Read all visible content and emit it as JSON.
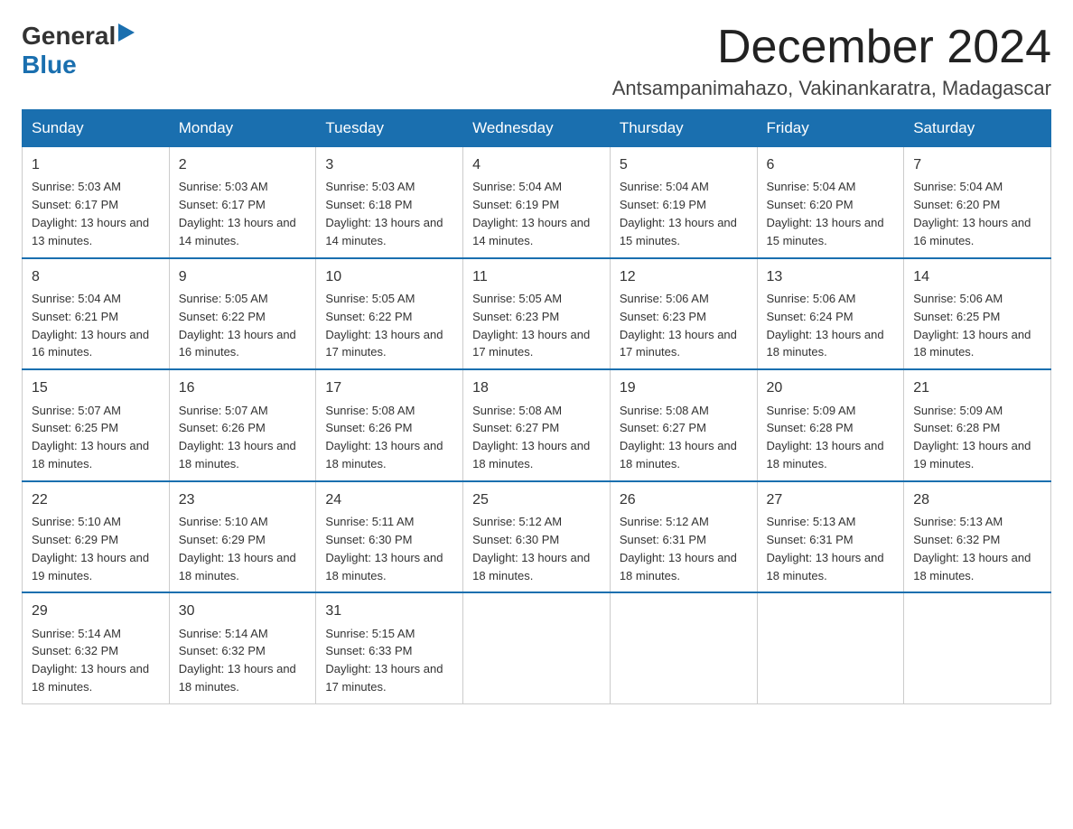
{
  "logo": {
    "general": "General",
    "blue": "Blue"
  },
  "title": {
    "month": "December 2024",
    "location": "Antsampanimahazo, Vakinankaratra, Madagascar"
  },
  "weekdays": [
    "Sunday",
    "Monday",
    "Tuesday",
    "Wednesday",
    "Thursday",
    "Friday",
    "Saturday"
  ],
  "weeks": [
    [
      {
        "num": "1",
        "sunrise": "5:03 AM",
        "sunset": "6:17 PM",
        "daylight": "13 hours and 13 minutes."
      },
      {
        "num": "2",
        "sunrise": "5:03 AM",
        "sunset": "6:17 PM",
        "daylight": "13 hours and 14 minutes."
      },
      {
        "num": "3",
        "sunrise": "5:03 AM",
        "sunset": "6:18 PM",
        "daylight": "13 hours and 14 minutes."
      },
      {
        "num": "4",
        "sunrise": "5:04 AM",
        "sunset": "6:19 PM",
        "daylight": "13 hours and 14 minutes."
      },
      {
        "num": "5",
        "sunrise": "5:04 AM",
        "sunset": "6:19 PM",
        "daylight": "13 hours and 15 minutes."
      },
      {
        "num": "6",
        "sunrise": "5:04 AM",
        "sunset": "6:20 PM",
        "daylight": "13 hours and 15 minutes."
      },
      {
        "num": "7",
        "sunrise": "5:04 AM",
        "sunset": "6:20 PM",
        "daylight": "13 hours and 16 minutes."
      }
    ],
    [
      {
        "num": "8",
        "sunrise": "5:04 AM",
        "sunset": "6:21 PM",
        "daylight": "13 hours and 16 minutes."
      },
      {
        "num": "9",
        "sunrise": "5:05 AM",
        "sunset": "6:22 PM",
        "daylight": "13 hours and 16 minutes."
      },
      {
        "num": "10",
        "sunrise": "5:05 AM",
        "sunset": "6:22 PM",
        "daylight": "13 hours and 17 minutes."
      },
      {
        "num": "11",
        "sunrise": "5:05 AM",
        "sunset": "6:23 PM",
        "daylight": "13 hours and 17 minutes."
      },
      {
        "num": "12",
        "sunrise": "5:06 AM",
        "sunset": "6:23 PM",
        "daylight": "13 hours and 17 minutes."
      },
      {
        "num": "13",
        "sunrise": "5:06 AM",
        "sunset": "6:24 PM",
        "daylight": "13 hours and 18 minutes."
      },
      {
        "num": "14",
        "sunrise": "5:06 AM",
        "sunset": "6:25 PM",
        "daylight": "13 hours and 18 minutes."
      }
    ],
    [
      {
        "num": "15",
        "sunrise": "5:07 AM",
        "sunset": "6:25 PM",
        "daylight": "13 hours and 18 minutes."
      },
      {
        "num": "16",
        "sunrise": "5:07 AM",
        "sunset": "6:26 PM",
        "daylight": "13 hours and 18 minutes."
      },
      {
        "num": "17",
        "sunrise": "5:08 AM",
        "sunset": "6:26 PM",
        "daylight": "13 hours and 18 minutes."
      },
      {
        "num": "18",
        "sunrise": "5:08 AM",
        "sunset": "6:27 PM",
        "daylight": "13 hours and 18 minutes."
      },
      {
        "num": "19",
        "sunrise": "5:08 AM",
        "sunset": "6:27 PM",
        "daylight": "13 hours and 18 minutes."
      },
      {
        "num": "20",
        "sunrise": "5:09 AM",
        "sunset": "6:28 PM",
        "daylight": "13 hours and 18 minutes."
      },
      {
        "num": "21",
        "sunrise": "5:09 AM",
        "sunset": "6:28 PM",
        "daylight": "13 hours and 19 minutes."
      }
    ],
    [
      {
        "num": "22",
        "sunrise": "5:10 AM",
        "sunset": "6:29 PM",
        "daylight": "13 hours and 19 minutes."
      },
      {
        "num": "23",
        "sunrise": "5:10 AM",
        "sunset": "6:29 PM",
        "daylight": "13 hours and 18 minutes."
      },
      {
        "num": "24",
        "sunrise": "5:11 AM",
        "sunset": "6:30 PM",
        "daylight": "13 hours and 18 minutes."
      },
      {
        "num": "25",
        "sunrise": "5:12 AM",
        "sunset": "6:30 PM",
        "daylight": "13 hours and 18 minutes."
      },
      {
        "num": "26",
        "sunrise": "5:12 AM",
        "sunset": "6:31 PM",
        "daylight": "13 hours and 18 minutes."
      },
      {
        "num": "27",
        "sunrise": "5:13 AM",
        "sunset": "6:31 PM",
        "daylight": "13 hours and 18 minutes."
      },
      {
        "num": "28",
        "sunrise": "5:13 AM",
        "sunset": "6:32 PM",
        "daylight": "13 hours and 18 minutes."
      }
    ],
    [
      {
        "num": "29",
        "sunrise": "5:14 AM",
        "sunset": "6:32 PM",
        "daylight": "13 hours and 18 minutes."
      },
      {
        "num": "30",
        "sunrise": "5:14 AM",
        "sunset": "6:32 PM",
        "daylight": "13 hours and 18 minutes."
      },
      {
        "num": "31",
        "sunrise": "5:15 AM",
        "sunset": "6:33 PM",
        "daylight": "13 hours and 17 minutes."
      },
      null,
      null,
      null,
      null
    ]
  ],
  "labels": {
    "sunrise": "Sunrise:",
    "sunset": "Sunset:",
    "daylight": "Daylight:"
  }
}
